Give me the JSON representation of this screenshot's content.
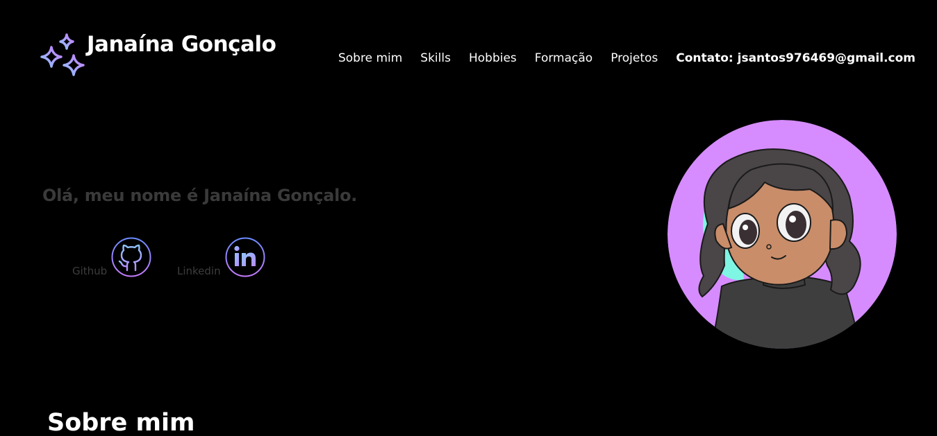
{
  "header": {
    "brand": "Janaína Gonçalo",
    "logo_icon": "sparkles-icon"
  },
  "nav": {
    "items": [
      {
        "label": "Sobre mim"
      },
      {
        "label": "Skills"
      },
      {
        "label": "Hobbies"
      },
      {
        "label": "Formação"
      },
      {
        "label": "Projetos"
      }
    ],
    "contact": "Contato: jsantos976469@gmail.com"
  },
  "hero": {
    "greeting": "Olá, meu nome é Janaína Gonçalo.",
    "social": [
      {
        "label": "Github",
        "icon": "github-icon"
      },
      {
        "label": "Linkedin",
        "icon": "linkedin-icon"
      }
    ],
    "avatar_icon": "avatar-illustration"
  },
  "section": {
    "title": "Sobre mim"
  },
  "colors": {
    "background": "#000000",
    "text": "#ffffff",
    "muted": "#3a3a3a",
    "gradient_blue": "#8ec5ff",
    "gradient_purple": "#c77dff",
    "avatar_bg": "#d68cff",
    "avatar_accent": "#7ff5e3"
  }
}
